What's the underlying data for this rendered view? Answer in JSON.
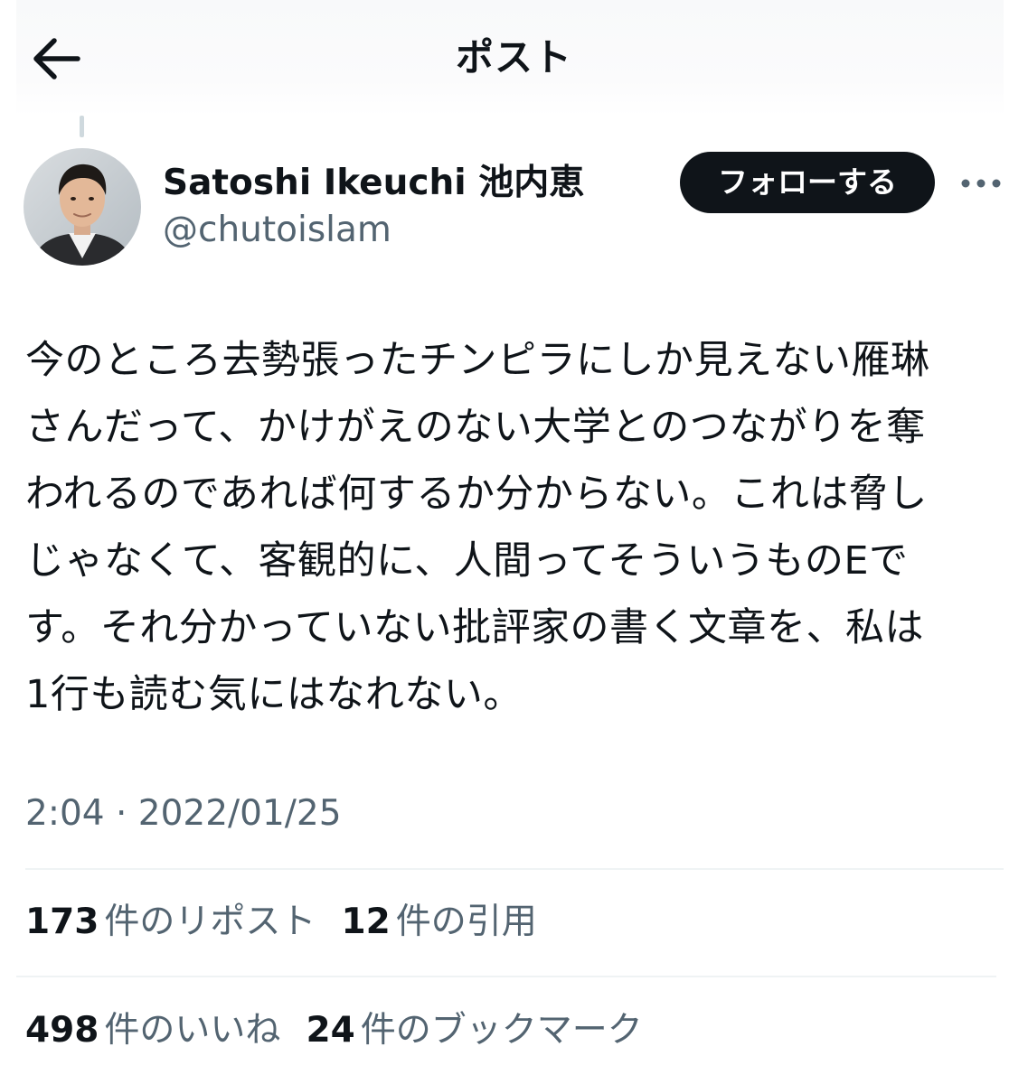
{
  "header": {
    "back_icon": "arrow-left-icon",
    "title": "ポスト"
  },
  "author": {
    "display_name": "Satoshi Ikeuchi 池内恵",
    "handle": "@chutoislam",
    "follow_label": "フォローする",
    "more_icon": "ellipsis-icon"
  },
  "post": {
    "text": "今のところ去勢張ったチンピラにしか見えない雁琳\nさんだって、かけがえのない大学とのつながりを奪\nわれるのであれば何するか分からない。これは脅し\nじゃなくて、客観的に、人間ってそういうものEで\nす。それ分かっていない批評家の書く文章を、私は\n1行も読む気にはなれない。",
    "timestamp": "2:04 · 2022/01/25"
  },
  "stats": {
    "reposts_count": "173",
    "reposts_label": "件のリポスト",
    "quotes_count": "12",
    "quotes_label": "件の引用",
    "likes_count": "498",
    "likes_label": "件のいいね",
    "bookmarks_count": "24",
    "bookmarks_label": "件のブックマーク"
  },
  "colors": {
    "text_primary": "#0f1419",
    "text_secondary": "#536471",
    "divider": "#eff3f4",
    "follow_bg": "#0f1419"
  }
}
